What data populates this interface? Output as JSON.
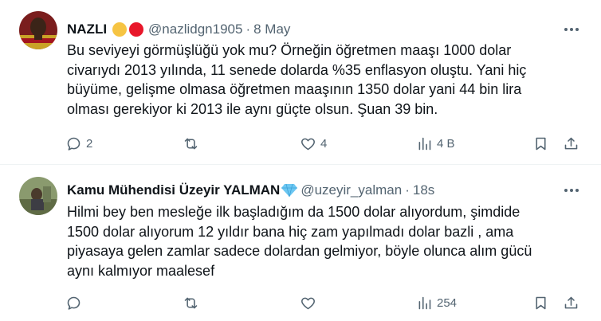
{
  "tweets": [
    {
      "name": "NAZLI",
      "handle": "@nazlidgn1905",
      "separator": "·",
      "time": "8 May",
      "badge_colors": [
        "#f6c443",
        "#e8172a"
      ],
      "text": "Bu seviyeyi görmüşlüğü yok mu? Örneğin öğretmen maaşı 1000 dolar\ncivarıydı 2013 yılında, 11 senede dolarda %35 enflasyon oluştu. Yani hiç\nbüyüme, gelişme olmasa öğretmen maaşının 1350 dolar yani 44 bin lira\nolması gerekiyor ki 2013 ile aynı güçte olsun. Şuan 39 bin.",
      "actions": {
        "replies": "2",
        "retweets": "",
        "likes": "4",
        "views": "4 B"
      }
    },
    {
      "name": "Kamu Mühendisi Üzeyir YALMAN",
      "handle": "@uzeyir_yalman",
      "separator": "·",
      "time": "18s",
      "badge_colors": [
        "#6cc7f2"
      ],
      "text": "Hilmi bey ben mesleğe ilk başladığım da 1500 dolar alıyordum, şimdide\n1500 dolar alıyorum 12 yıldır bana hiç zam yapılmadı dolar bazli , ama\npiyasaya gelen zamlar sadece dolardan gelmiyor, böyle olunca alım gücü\naynı kalmıyor maalesef",
      "actions": {
        "replies": "",
        "retweets": "",
        "likes": "",
        "views": "254"
      }
    }
  ],
  "colors": {
    "text": "#0f1419",
    "secondary": "#536471",
    "divider": "#eff3f4"
  }
}
